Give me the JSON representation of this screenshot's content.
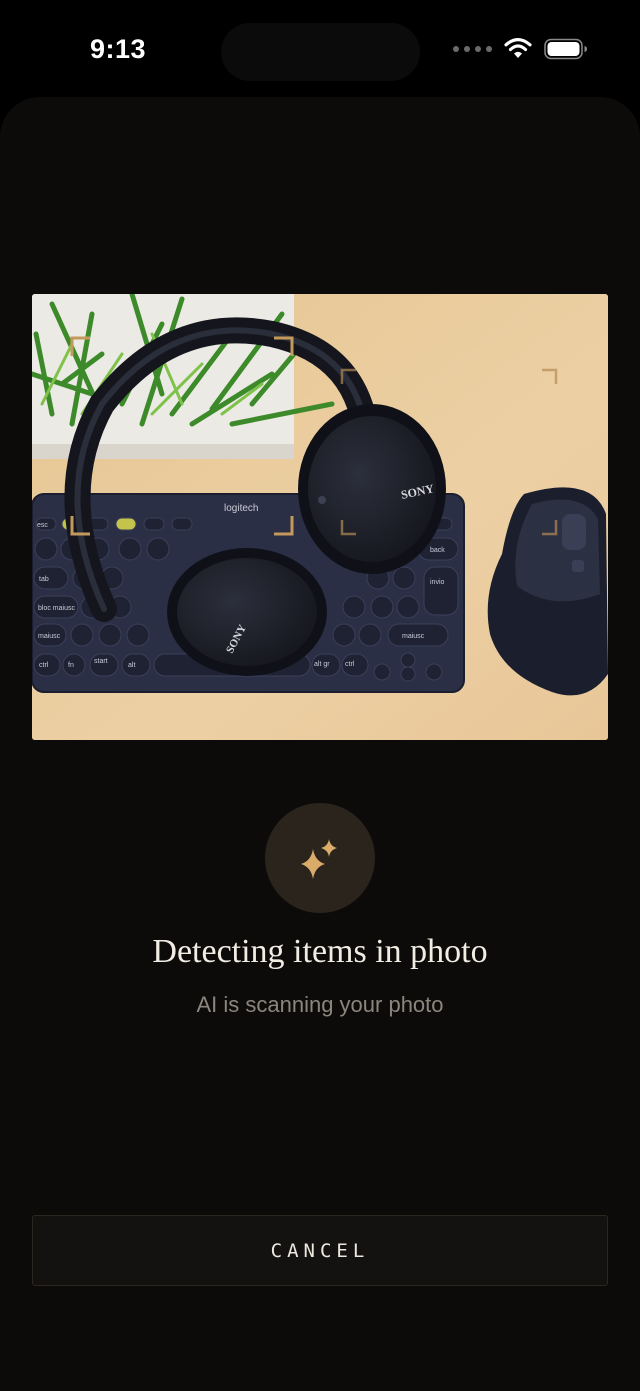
{
  "status_bar": {
    "time": "9:13"
  },
  "photo": {
    "keyboard_brand": "logitech",
    "headphone_brand_top": "SONY",
    "headphone_brand_bottom": "SONY",
    "key_labels": [
      "esc",
      "tab",
      "bloc maiusc",
      "maiusc",
      "ctrl",
      "fn",
      "start",
      "alt",
      "back",
      "invio",
      "maiusc",
      "alt gr",
      "ctrl"
    ],
    "accent_color": "#c49a5c"
  },
  "detect": {
    "icon": "sparkles-icon",
    "title": "Detecting items in photo",
    "subtitle": "AI is scanning your photo"
  },
  "actions": {
    "cancel_label": "CANCEL"
  },
  "colors": {
    "background": "#0d0b09",
    "accent": "#c49a5c",
    "icon_circle": "#2a241d",
    "title": "#f1ece4",
    "subtitle": "#8b857d"
  }
}
